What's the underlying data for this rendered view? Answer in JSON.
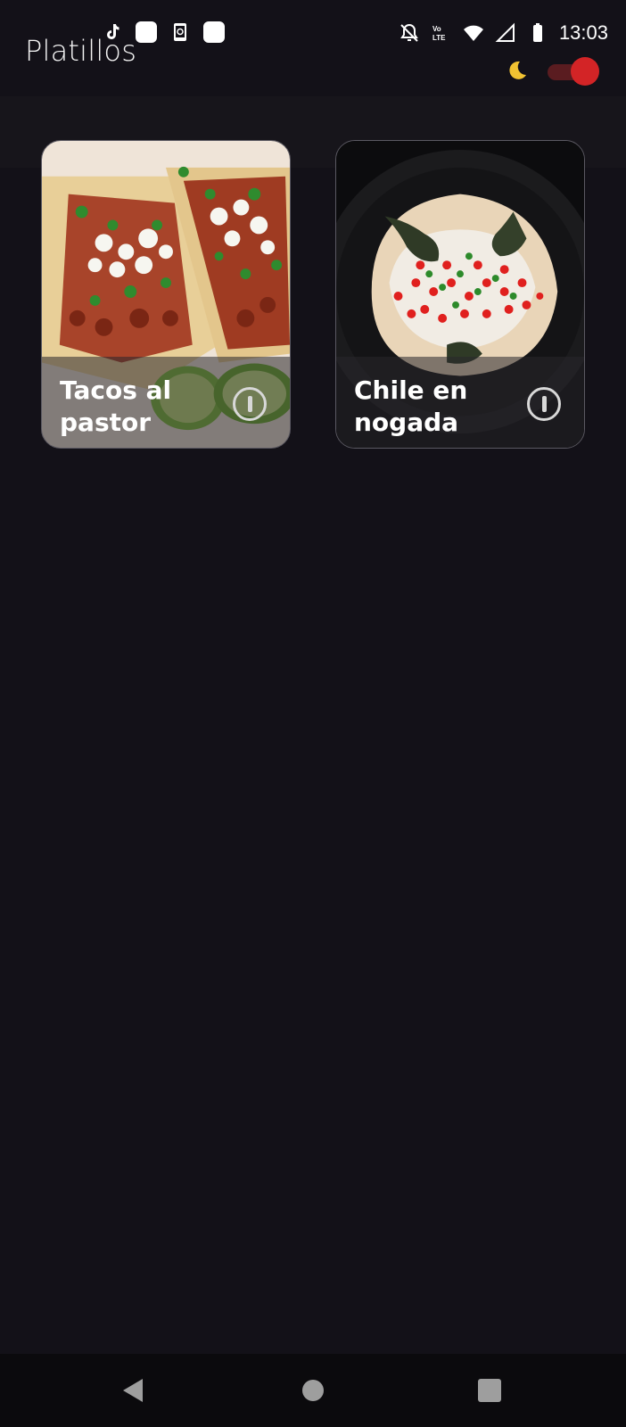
{
  "status_bar": {
    "time": "13:03",
    "left_icons": [
      "tiktok-icon",
      "notification-square-icon",
      "phone-sync-icon",
      "notification-square-icon"
    ],
    "right_icons": [
      "bell-off-icon",
      "volte-icon",
      "wifi-icon",
      "signal-icon",
      "battery-icon"
    ],
    "volte_label": "Vo LTE"
  },
  "app_bar": {
    "title": "Platillos",
    "theme_icon": "moon-icon",
    "dark_mode_enabled": true,
    "toggle_color": "#d32426"
  },
  "dishes": [
    {
      "name": "Tacos al pastor",
      "info_icon": "info-icon"
    },
    {
      "name": "Chile en nogada",
      "info_icon": "info-icon"
    }
  ],
  "nav_bar": {
    "buttons": [
      "back-icon",
      "home-icon",
      "recents-icon"
    ]
  },
  "colors": {
    "background": "#131118",
    "accent": "#d32426",
    "card_border": "#5b5962"
  }
}
